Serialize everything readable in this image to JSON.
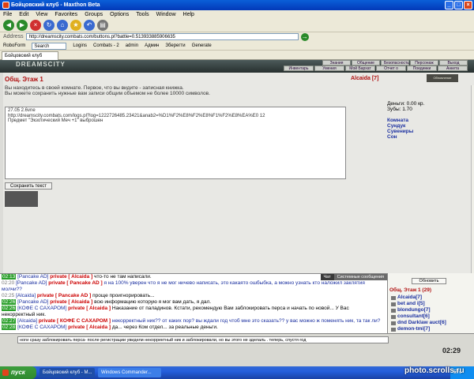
{
  "window": {
    "title": "Бойцовский клуб - Maxthon Beta"
  },
  "menu": [
    "File",
    "Edit",
    "View",
    "Favorites",
    "Groups",
    "Options",
    "Tools",
    "Window",
    "Help"
  ],
  "address": {
    "label": "Address",
    "url": "http://dreamscity.combats.com/buttons.pl?battle=0.513933885906635"
  },
  "links": {
    "roboform": "RoboForm",
    "search": "Search",
    "logins": "Logins",
    "combats": "Combats - 2",
    "admin": "admin",
    "admin2": "Админ",
    "save": "Зберегти",
    "generate": "Generate"
  },
  "tab": {
    "label": "Бойцовский клуб"
  },
  "game": {
    "logo": "DREAMSCITY",
    "nav1": [
      "Знания",
      "Общение",
      "Безопасность",
      "Персонаж",
      "Выход"
    ],
    "nav2": [
      "Инвентарь",
      "Умения",
      "Мой Бархат",
      "Отчет о переводах",
      "Поединки",
      "Анкета"
    ],
    "room_title": "Общ. Этаж 1",
    "user": "Alcaida [7]",
    "info": [
      "Вы находитесь в своей комнате. Первое, что вы видите - записная книжка.",
      "Вы можете сохранить нужные вам записи общим объемом не более 10000 символов."
    ],
    "note_lines": [
      "27.05  2.6vne",
      "http://dreamscity.combats.com/logs.pl?log=1222726485.23421&anab2=%D1%F2%E8%F2%E8%F1%F2%E8%EA%E0  12",
      "Предмет \"Экзотический Меч +1\" выброшен"
    ],
    "save_button": "Сохранить текст",
    "money": "Деньги: 0.00 кр.",
    "teeth": "Зубы: 1.70",
    "room_links": [
      "Комната",
      "Сундук",
      "Сувениры",
      "Сон"
    ],
    "mini_labels": [
      "Обновление",
      "Общ. Этаж 2"
    ]
  },
  "chat": {
    "tabs": [
      "Чат",
      "Системные сообщения"
    ],
    "messages": [
      {
        "time": "02:13",
        "author": "[Pancake AD]",
        "priv": "private [ Alcaida ]",
        "text": "что-то не там написали."
      },
      {
        "time": "02:20",
        "author": "[Pancake AD]",
        "priv": "private [ Pancake AD ]",
        "text": "я на 100% уверен что я не мог ничево написать, это какаято ошбыбка, а можно узнать кто наложил заклятия молчи??"
      },
      {
        "time": "02:25",
        "author": "[Alcaida]",
        "priv": "private [ Pancake AD ]",
        "text": "проще проигнорировать..."
      },
      {
        "time": "02:26",
        "author": "[Pancake AD]",
        "priv": "private [ Alcaida ]",
        "text": "всю информацию которую я мог вам дать, я дал."
      },
      {
        "time": "02:26",
        "author": "[КОФЕ С САХАРОМ]",
        "priv": "private [ Alcaida ]",
        "text": "Наказание от паладинов. Кстати, рекомендую Вам заблокировать перса и начать по новой... У Вас некорректный ник."
      },
      {
        "time": "02:26",
        "author": "[КОФЕ С САХАРОМ]",
        "priv": "private [ Alcaida ]",
        "text": "Наказание от паладинов. Кстати, рекомендую Вам заблокировать перса и начать по новой... У Вас некорректный ник."
      },
      {
        "time": "02:27",
        "author": "[Alcaida]",
        "priv": "private [ КОФЕ С САХАРОМ ]",
        "text": "некорректный ник?? от каких пор? вы ждали год чтоб мне это сказать?? у вас можно ж поменять ник, та так ли?"
      },
      {
        "time": "02:28",
        "author": "[КОФЕ С САХАРОМ]",
        "priv": "private [ Alcaida ]",
        "text": "да... через Ком отдел... за реальные деньги."
      }
    ],
    "input": "ноги сразу заблокировать перса- после регистрации увидели некорректный ник и заблокировали, но вы этого не зделаль . теперь, спустя год"
  },
  "users": {
    "refresh": "Обновить",
    "floor": "Общ. Этаж 1 (29)",
    "list": [
      "Alcaida[7]",
      "bet and i[5]",
      "blondungo[7]",
      "consultant[6]",
      "dnd Darklaw auct[6]",
      "demon-tmi[7]",
      "Fire of Desire[7]"
    ]
  },
  "clock": "02:29",
  "taskbar": {
    "start": "пуск",
    "tasks": [
      "Бойцовский клуб - M...",
      "Windows Commander..."
    ],
    "tray": "EN"
  },
  "watermark": "photo.scrolls.ru"
}
